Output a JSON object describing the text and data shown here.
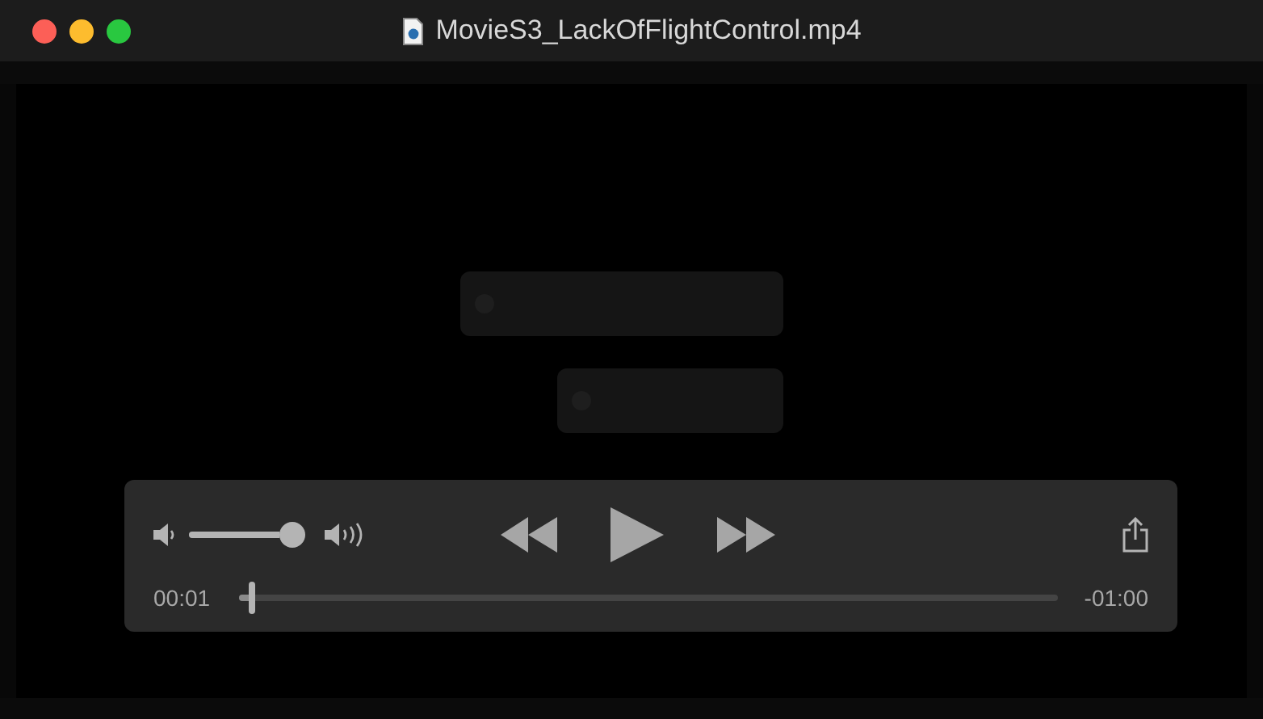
{
  "window": {
    "title": "MovieS3_LackOfFlightControl.mp4"
  },
  "controls": {
    "volume": {
      "level": 1.0
    },
    "progress": {
      "level": 0.015
    },
    "elapsed": "00:01",
    "remaining": "-01:00"
  }
}
